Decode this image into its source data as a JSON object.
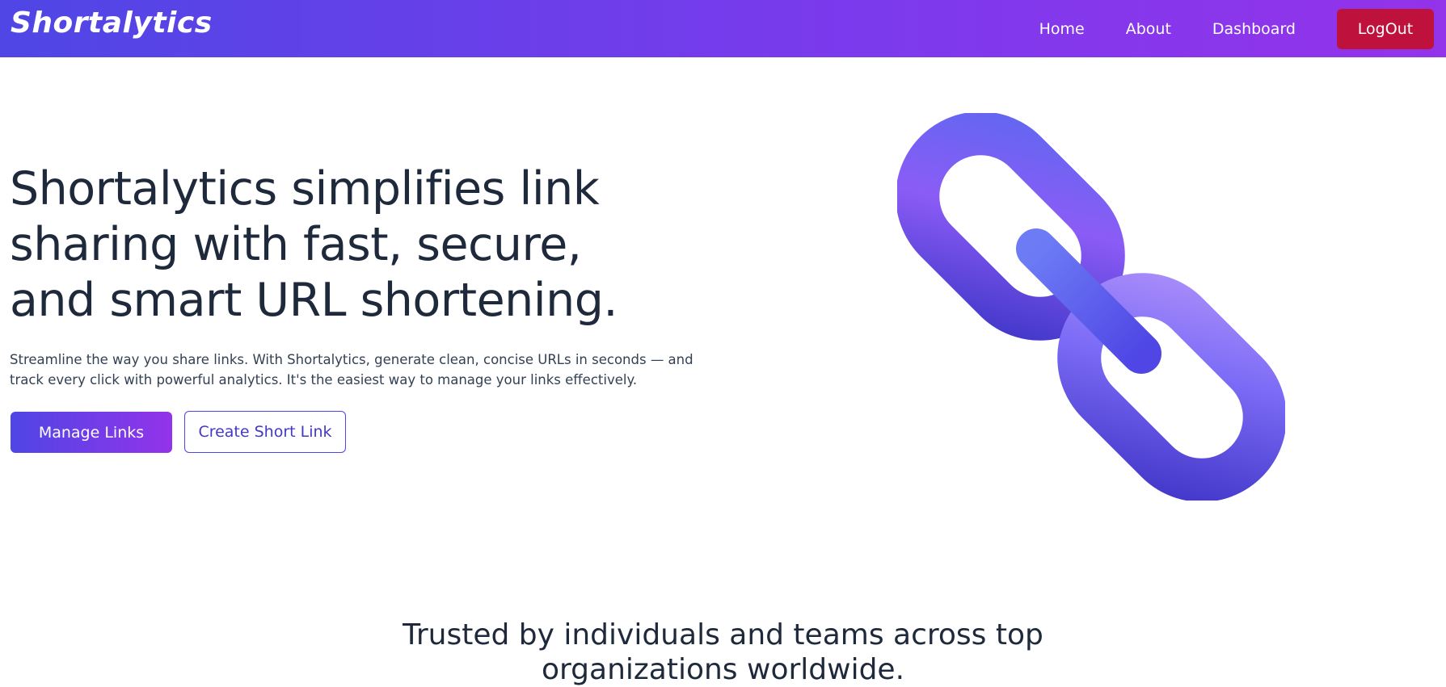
{
  "navbar": {
    "brand": "Shortalytics",
    "links": [
      {
        "label": "Home"
      },
      {
        "label": "About"
      },
      {
        "label": "Dashboard"
      }
    ],
    "logout_label": "LogOut"
  },
  "hero": {
    "title": "Shortalytics simplifies link sharing with fast, secure, and smart URL shortening.",
    "description": "Streamline the way you share links. With Shortalytics, generate clean, concise URLs in seconds — and track every click with powerful analytics. It's the easiest way to manage your links effectively.",
    "primary_button": "Manage Links",
    "secondary_button": "Create Short Link",
    "illustration": "chain-link-icon"
  },
  "trusted": {
    "heading": "Trusted by individuals and teams across top organizations worldwide."
  },
  "colors": {
    "nav_gradient_start": "#4f46e5",
    "nav_gradient_end": "#9333ea",
    "logout": "#be123c",
    "heading_text": "#1e293b",
    "accent": "#4f46e5"
  }
}
